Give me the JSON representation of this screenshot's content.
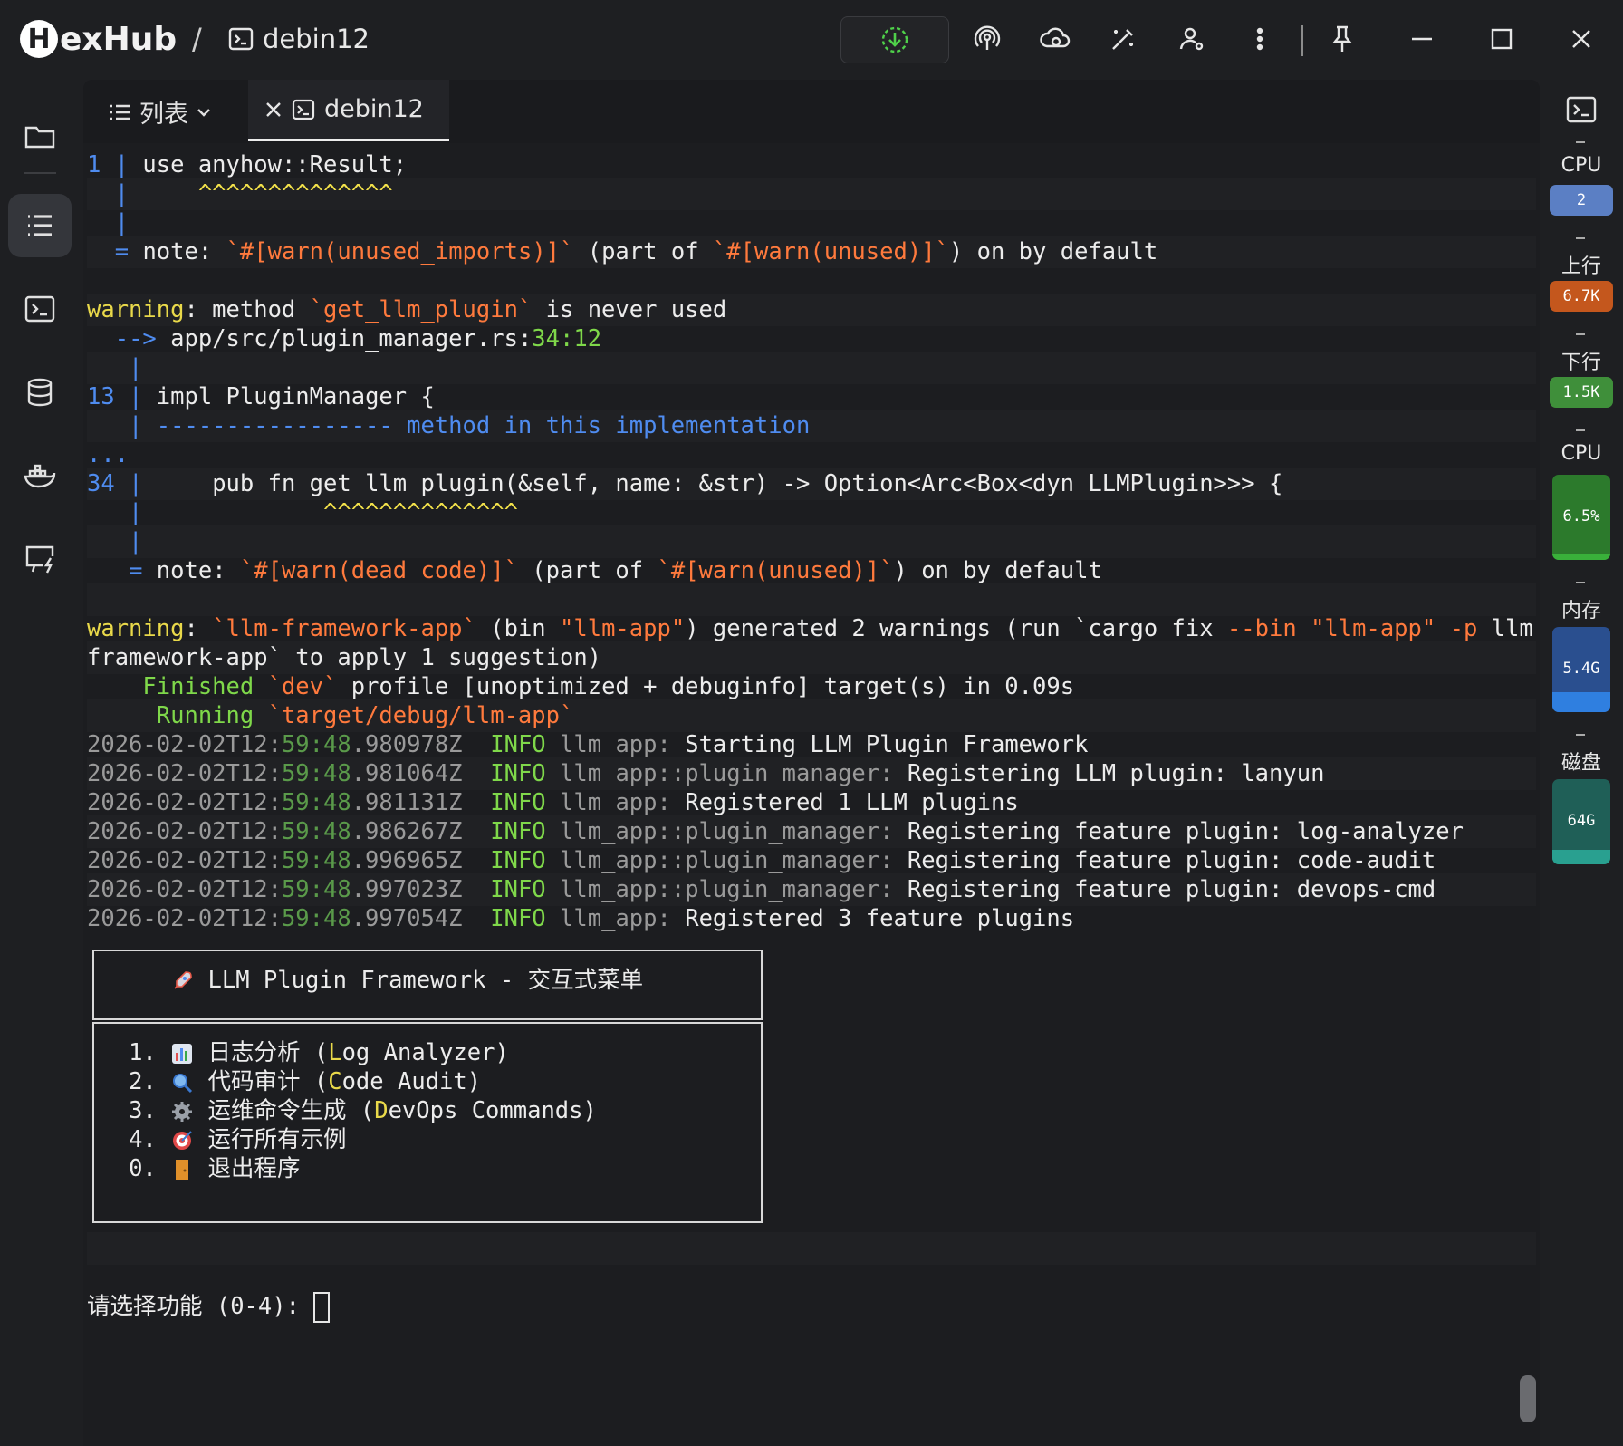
{
  "app": {
    "logo_letter": "H",
    "logo_rest": "exHub",
    "separator": "/",
    "host_label": "debin12"
  },
  "tabs": {
    "list_label": "列表",
    "active_tab_label": "debin12"
  },
  "terminal": {
    "l1_num": "1",
    "l1_code": "use anyhow::Result;",
    "carets_a": "^^^^^^^^^^^^^^",
    "note1_pre": "= ",
    "note1_word": "note: ",
    "note1_attr": "`#[warn(unused_imports)]`",
    "note1_mid": " (part of ",
    "note1_attr2": "`#[warn(unused)]`",
    "note1_post": ") on by default",
    "warn_word": "warning",
    "w1_pre": ": method ",
    "w1_name": "`get_llm_plugin`",
    "w1_post": " is never used",
    "arrow": "-->",
    "w1_path": " app/src/plugin_manager.rs:",
    "w1_pos": "34:12",
    "l13_num": "13",
    "l13_code": "impl PluginManager {",
    "l13_dash": "----------------- method in this implementation",
    "ellipsis": "...",
    "l34_num": "34",
    "l34_code": "    pub fn get_llm_plugin(&self, name: &str) -> Option<Arc<Box<dyn LLMPlugin>>> {",
    "carets_b": "^^^^^^^^^^^^^^",
    "note2_pre": "= ",
    "note2_word": "note: ",
    "note2_attr": "`#[warn(dead_code)]`",
    "note2_mid": " (part of ",
    "note2_attr2": "`#[warn(unused)]`",
    "note2_post": ") on by default",
    "w2_name": "`llm-framework-app`",
    "w2_bin": " (bin ",
    "w2_binname": "\"llm-app\"",
    "w2_gen": ") generated 2 warnings (run `cargo fix ",
    "w2_flag": "--bin ",
    "w2_flagval": "\"llm-app\"",
    "w2_p": " -p ",
    "w2_tail": "llm-",
    "w2_line2": "framework-app` to apply 1 suggestion)",
    "finished_word": "Finished",
    "finished_profile": " `dev`",
    "finished_rest": " profile [unoptimized + debuginfo] target(s) in 0.09s",
    "running_word": "Running",
    "running_target": " `target/debug/llm-app`",
    "logs": [
      {
        "date": "2026-02-02T12:",
        "time": "59:48",
        "frac": ".980978Z",
        "level": "INFO",
        "module": "llm_app:",
        "msg": "Starting LLM Plugin Framework"
      },
      {
        "date": "2026-02-02T12:",
        "time": "59:48",
        "frac": ".981064Z",
        "level": "INFO",
        "module": "llm_app::plugin_manager:",
        "msg": "Registering LLM plugin: lanyun"
      },
      {
        "date": "2026-02-02T12:",
        "time": "59:48",
        "frac": ".981131Z",
        "level": "INFO",
        "module": "llm_app:",
        "msg": "Registered 1 LLM plugins"
      },
      {
        "date": "2026-02-02T12:",
        "time": "59:48",
        "frac": ".986267Z",
        "level": "INFO",
        "module": "llm_app::plugin_manager:",
        "msg": "Registering feature plugin: log-analyzer"
      },
      {
        "date": "2026-02-02T12:",
        "time": "59:48",
        "frac": ".996965Z",
        "level": "INFO",
        "module": "llm_app::plugin_manager:",
        "msg": "Registering feature plugin: code-audit"
      },
      {
        "date": "2026-02-02T12:",
        "time": "59:48",
        "frac": ".997023Z",
        "level": "INFO",
        "module": "llm_app::plugin_manager:",
        "msg": "Registering feature plugin: devops-cmd"
      },
      {
        "date": "2026-02-02T12:",
        "time": "59:48",
        "frac": ".997054Z",
        "level": "INFO",
        "module": "llm_app:",
        "msg": "Registered 3 feature plugins"
      }
    ],
    "menu_title": "LLM Plugin Framework - 交互式菜单",
    "menu_items": [
      {
        "num": "1.",
        "label": "日志分析 (",
        "first": "L",
        "rest": "og Analyzer)",
        "icon": "bar-chart-icon"
      },
      {
        "num": "2.",
        "label": "代码审计 (",
        "first": "C",
        "rest": "ode Audit)",
        "icon": "magnifier-icon"
      },
      {
        "num": "3.",
        "label": "运维命令生成 (",
        "first": "D",
        "rest": "evOps Commands)",
        "icon": "gear-icon"
      },
      {
        "num": "4.",
        "label": "运行所有示例",
        "first": "",
        "rest": "",
        "icon": "target-icon"
      },
      {
        "num": "0.",
        "label": "退出程序",
        "first": "",
        "rest": "",
        "icon": "door-icon"
      }
    ],
    "prompt_text": "请选择功能 (0-4):"
  },
  "monitor": {
    "cpu_label": "CPU",
    "cpu_cores": "2",
    "up_label": "上行",
    "up_value": "6.7K",
    "down_label": "下行",
    "down_value": "1.5K",
    "cpu2_label": "CPU",
    "cpu_usage": "6.5%",
    "cpu_fill": 0.065,
    "mem_label": "内存",
    "mem_value": "5.4G",
    "disk_label": "磁盘",
    "disk_value": "64G"
  },
  "colors": {
    "accent_blue": "#4f8cf0",
    "warning_yellow": "#f2e14a",
    "orange": "#ff7a3d",
    "green": "#7fd84a"
  }
}
